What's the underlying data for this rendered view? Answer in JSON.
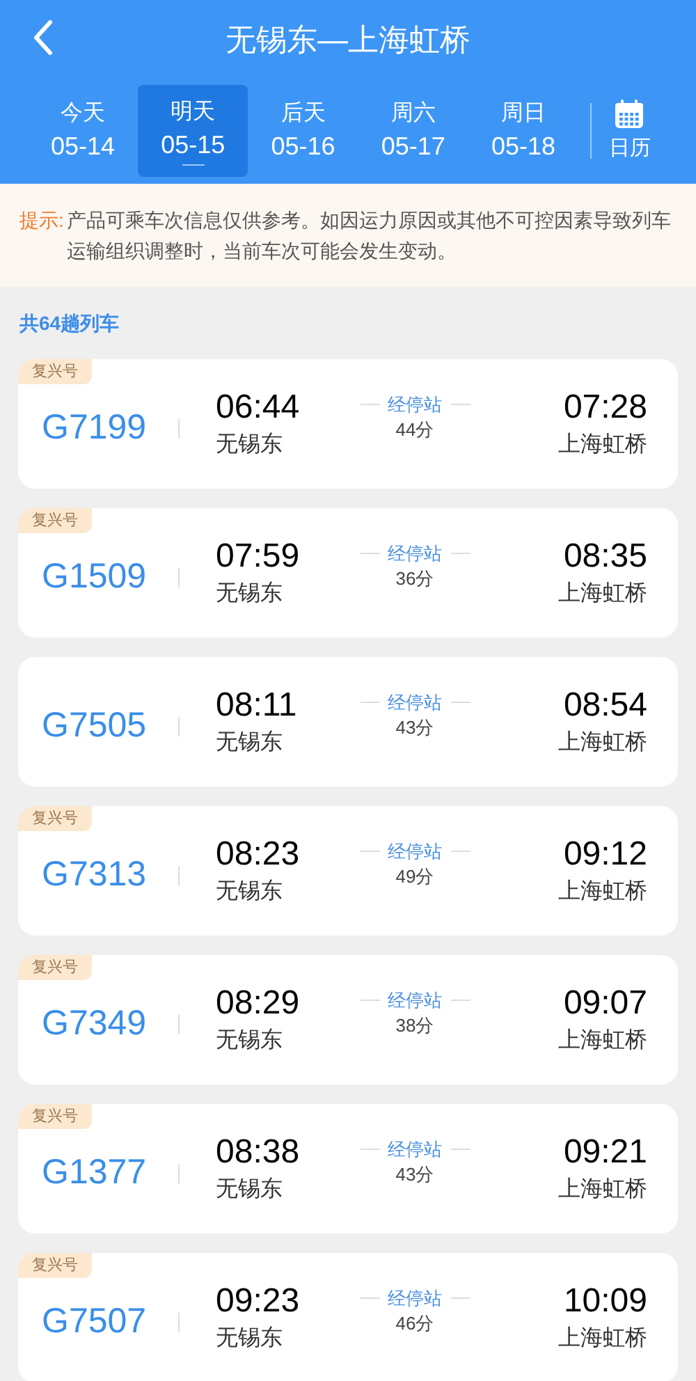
{
  "header": {
    "title": "无锡东—上海虹桥"
  },
  "date_tabs": [
    {
      "label": "今天",
      "date": "05-14",
      "selected": false
    },
    {
      "label": "明天",
      "date": "05-15",
      "selected": true
    },
    {
      "label": "后天",
      "date": "05-16",
      "selected": false
    },
    {
      "label": "周六",
      "date": "05-17",
      "selected": false
    },
    {
      "label": "周日",
      "date": "05-18",
      "selected": false
    }
  ],
  "calendar_button": {
    "label": "日历"
  },
  "notice": {
    "label": "提示:",
    "text": "产品可乘车次信息仅供参考。如因运力原因或其他不可控因素导致列车运输组织调整时，当前车次可能会发生变动。"
  },
  "train_count": "共64趟列车",
  "trains": [
    {
      "badge": "复兴号",
      "number": "G7199",
      "depart_time": "06:44",
      "depart_station": "无锡东",
      "stops_link": "经停站",
      "duration": "44分",
      "arrive_time": "07:28",
      "arrive_station": "上海虹桥"
    },
    {
      "badge": "复兴号",
      "number": "G1509",
      "depart_time": "07:59",
      "depart_station": "无锡东",
      "stops_link": "经停站",
      "duration": "36分",
      "arrive_time": "08:35",
      "arrive_station": "上海虹桥"
    },
    {
      "number": "G7505",
      "depart_time": "08:11",
      "depart_station": "无锡东",
      "stops_link": "经停站",
      "duration": "43分",
      "arrive_time": "08:54",
      "arrive_station": "上海虹桥"
    },
    {
      "badge": "复兴号",
      "number": "G7313",
      "depart_time": "08:23",
      "depart_station": "无锡东",
      "stops_link": "经停站",
      "duration": "49分",
      "arrive_time": "09:12",
      "arrive_station": "上海虹桥"
    },
    {
      "badge": "复兴号",
      "number": "G7349",
      "depart_time": "08:29",
      "depart_station": "无锡东",
      "stops_link": "经停站",
      "duration": "38分",
      "arrive_time": "09:07",
      "arrive_station": "上海虹桥"
    },
    {
      "badge": "复兴号",
      "number": "G1377",
      "depart_time": "08:38",
      "depart_station": "无锡东",
      "stops_link": "经停站",
      "duration": "43分",
      "arrive_time": "09:21",
      "arrive_station": "上海虹桥"
    },
    {
      "badge": "复兴号",
      "number": "G7507",
      "depart_time": "09:23",
      "depart_station": "无锡东",
      "stops_link": "经停站",
      "duration": "46分",
      "arrive_time": "10:09",
      "arrive_station": "上海虹桥"
    }
  ]
}
